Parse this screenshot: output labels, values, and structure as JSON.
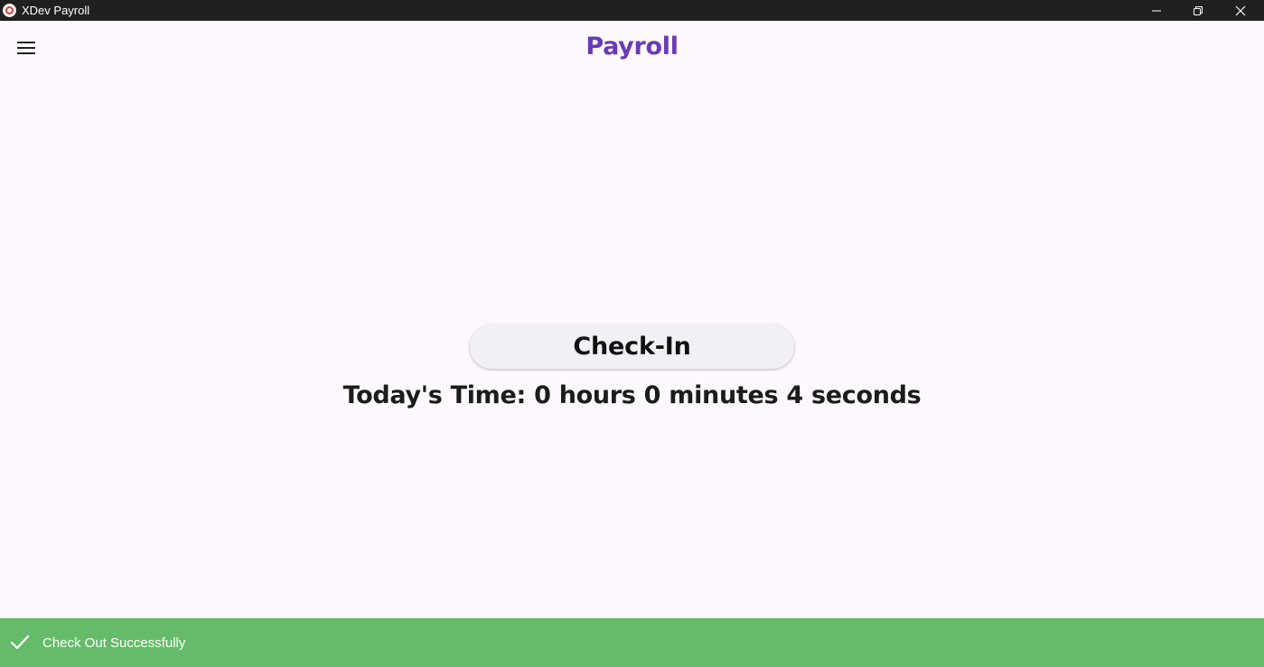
{
  "window": {
    "title": "XDev Payroll",
    "icon": "app-logo-icon"
  },
  "window_controls": {
    "minimize_icon": "minimize-icon",
    "restore_icon": "restore-icon",
    "close_icon": "close-icon"
  },
  "appbar": {
    "menu_icon": "hamburger-menu-icon",
    "title": "Payroll",
    "title_color": "#6a3ab8"
  },
  "main": {
    "checkin_button_label": "Check-In",
    "time_text": "Today's Time: 0 hours 0 minutes 4 seconds"
  },
  "snackbar": {
    "icon": "checkmark-icon",
    "message": "Check Out Successfully",
    "background_color": "#66bb6a"
  },
  "colors": {
    "background": "#fdf8fd",
    "titlebar": "#202020",
    "button_background": "#f3eff6"
  }
}
